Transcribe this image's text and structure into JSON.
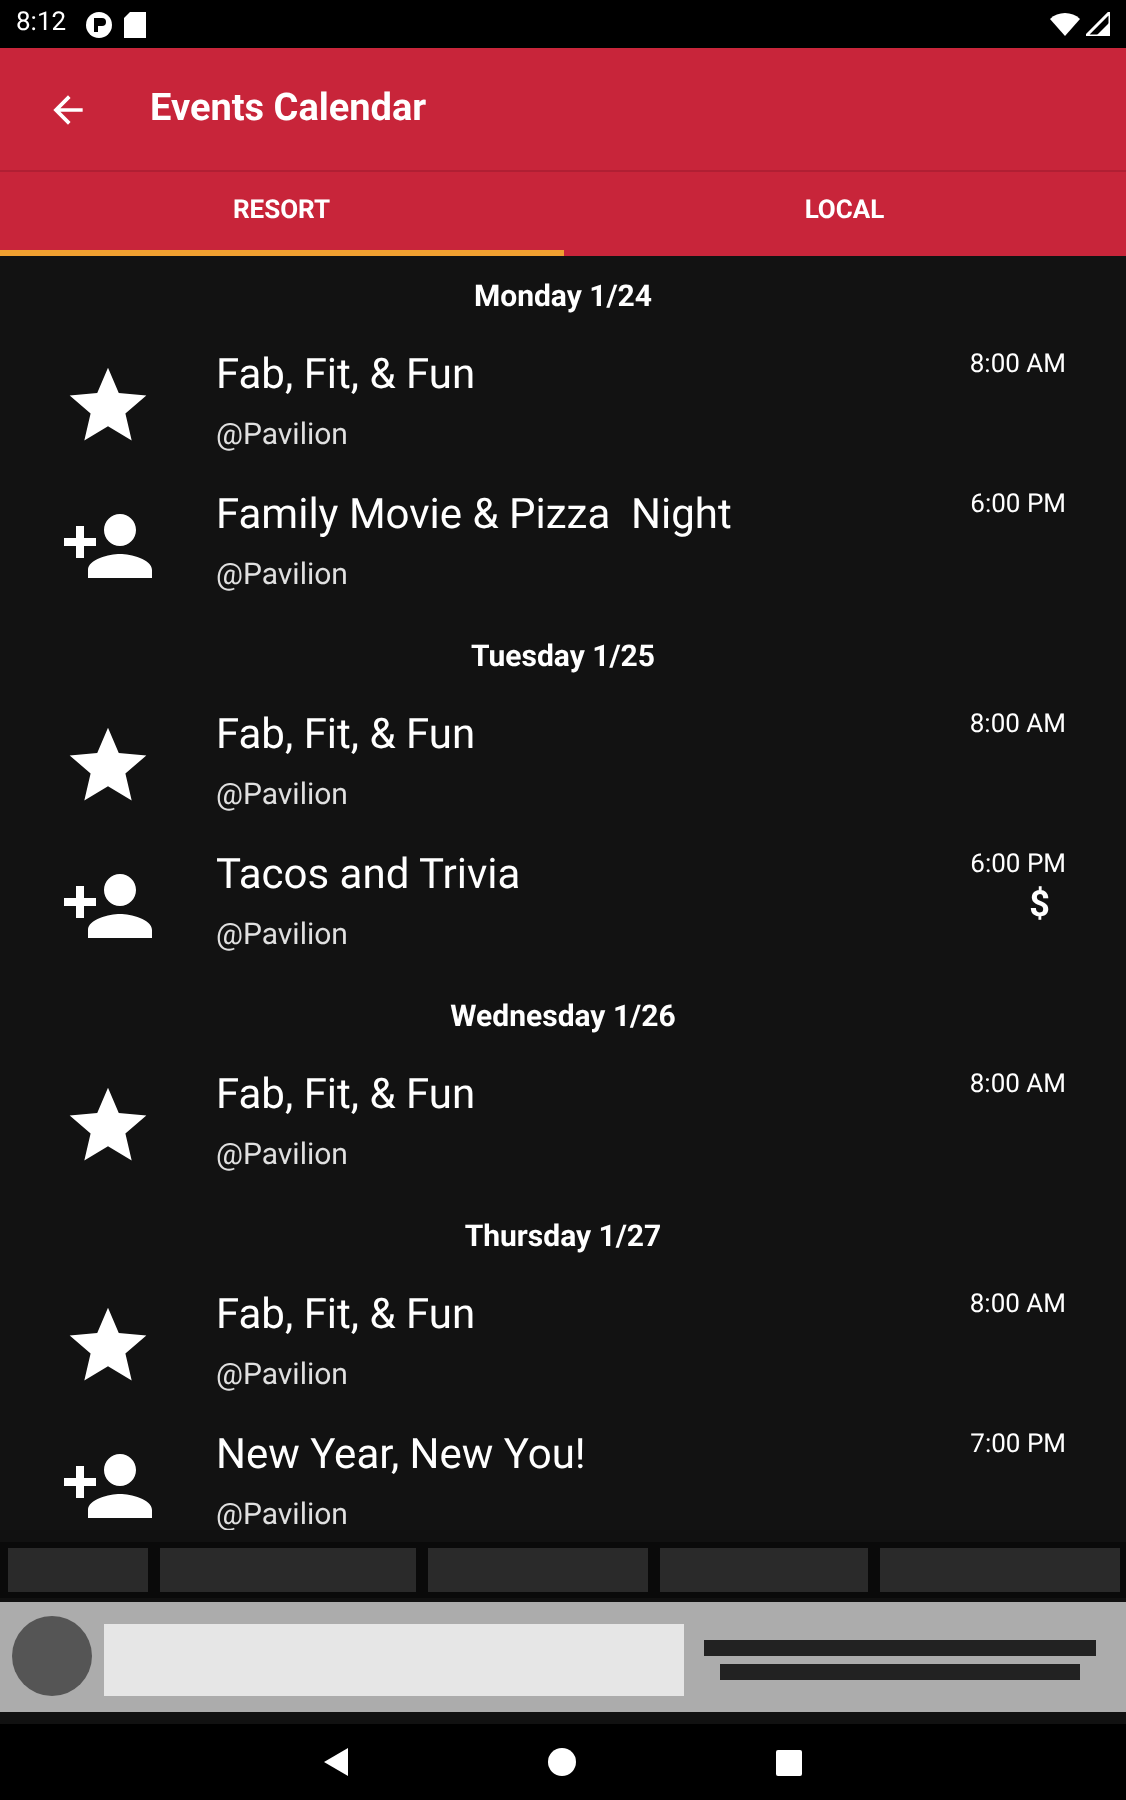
{
  "status_bar": {
    "time": "8:12"
  },
  "app_bar": {
    "title": "Events Calendar"
  },
  "tabs": [
    {
      "label": "RESORT",
      "selected": true
    },
    {
      "label": "LOCAL",
      "selected": false
    }
  ],
  "days": [
    {
      "date": "Monday 1/24",
      "events": [
        {
          "kind": "star",
          "title": "Fab, Fit, & Fun",
          "location": "@Pavilion",
          "time": "8:00 AM"
        },
        {
          "kind": "person-add",
          "title": "Family Movie & Pizza  Night",
          "location": "@Pavilion",
          "time": "6:00 PM"
        }
      ]
    },
    {
      "date": "Tuesday 1/25",
      "events": [
        {
          "kind": "star",
          "title": "Fab, Fit, & Fun",
          "location": "@Pavilion",
          "time": "8:00 AM"
        },
        {
          "kind": "person-add",
          "title": "Tacos and Trivia",
          "location": "@Pavilion",
          "time": "6:00 PM",
          "price": "$"
        }
      ]
    },
    {
      "date": "Wednesday 1/26",
      "events": [
        {
          "kind": "star",
          "title": "Fab, Fit, & Fun",
          "location": "@Pavilion",
          "time": "8:00 AM"
        }
      ]
    },
    {
      "date": "Thursday 1/27",
      "events": [
        {
          "kind": "star",
          "title": "Fab, Fit, & Fun",
          "location": "@Pavilion",
          "time": "8:00 AM"
        },
        {
          "kind": "person-add",
          "title": "New Year, New You!",
          "location": "@Pavilion",
          "time": "7:00 PM"
        }
      ]
    }
  ]
}
